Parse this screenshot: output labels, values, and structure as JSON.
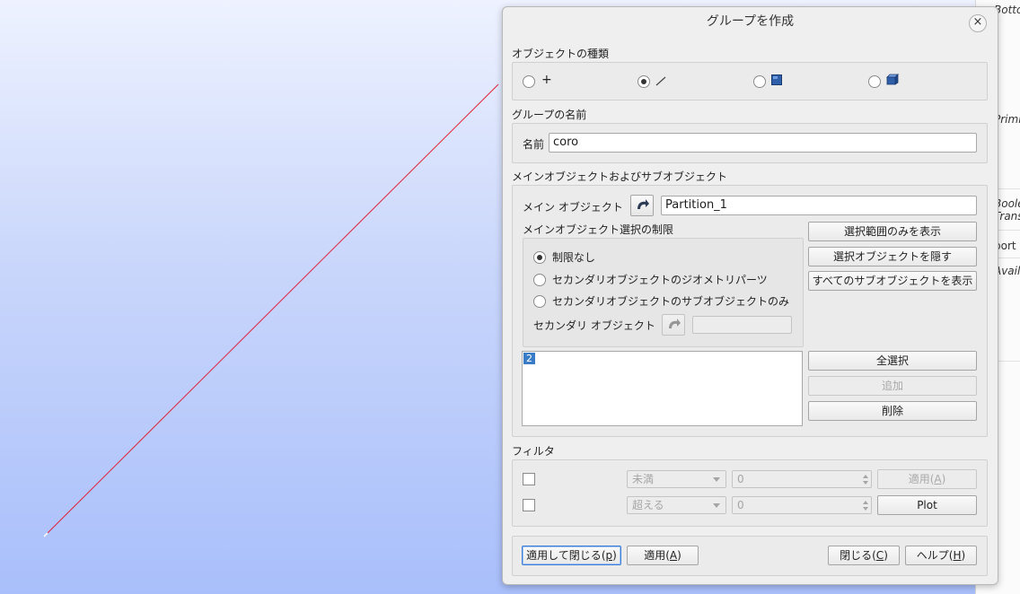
{
  "right_panel": {
    "items": [
      "Botto",
      "Primi",
      "Boole",
      "Trans",
      "port",
      "Availa"
    ]
  },
  "dialog": {
    "title": "グループを作成",
    "object_type": {
      "title": "オブジェクトの種類",
      "options": [
        {
          "name": "point",
          "glyph": "+",
          "selected": false
        },
        {
          "name": "edge",
          "glyph": "⁄",
          "selected": true
        },
        {
          "name": "face",
          "glyph": "",
          "selected": false
        },
        {
          "name": "solid",
          "glyph": "",
          "selected": false
        }
      ]
    },
    "group_name": {
      "title": "グループの名前",
      "label": "名前",
      "value": "coro"
    },
    "main_sub": {
      "title": "メインオブジェクトおよびサブオブジェクト",
      "main_object_label": "メイン オブジェクト",
      "main_object_value": "Partition_1",
      "restriction_title": "メインオブジェクト選択の制限",
      "restrictions": [
        {
          "label": "制限なし",
          "selected": true
        },
        {
          "label": "セカンダリオブジェクトのジオメトリパーツ",
          "selected": false
        },
        {
          "label": "セカンダリオブジェクトのサブオブジェクトのみ",
          "selected": false
        }
      ],
      "secondary_object_label": "セカンダリ オブジェクト",
      "secondary_object_value": "",
      "show_selected_only": "選択範囲のみを表示",
      "hide_selected": "選択オブジェクトを隠す",
      "show_all_sub": "すべてのサブオブジェクトを表示",
      "list_items": [
        "2"
      ],
      "select_all": "全選択",
      "add": "追加",
      "remove": "削除"
    },
    "filter": {
      "title": "フィルタ",
      "rows": [
        {
          "operator": "未満",
          "value": "0",
          "button": "適用(",
          "button_key": "A",
          "button_end": ")"
        },
        {
          "operator": "超える",
          "value": "0",
          "button": "Plot"
        }
      ]
    },
    "footer": {
      "apply_close_pre": "適用して閉じる(",
      "apply_close_key": "p",
      "apply_close_post": ")",
      "apply_pre": "適用(",
      "apply_key": "A",
      "apply_post": ")",
      "close_pre": "閉じる(",
      "close_key": "C",
      "close_post": ")",
      "help_pre": "ヘルプ(",
      "help_key": "H",
      "help_post": ")"
    }
  },
  "colors": {
    "edge_line": "#e0203a",
    "selection_blue": "#3a7cc7"
  }
}
